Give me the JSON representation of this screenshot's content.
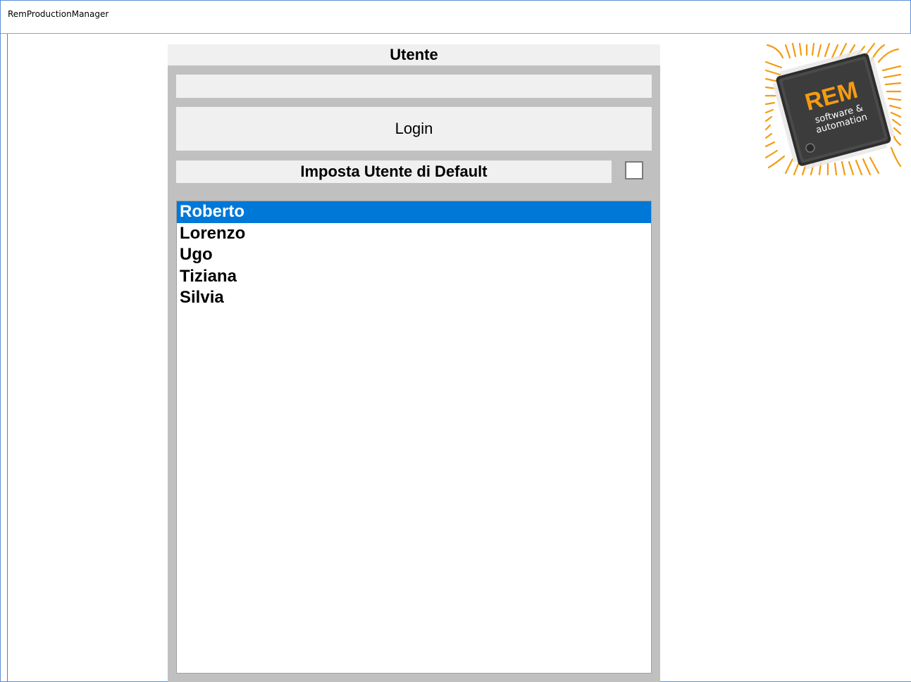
{
  "window": {
    "title": "RemProductionManager"
  },
  "panel": {
    "title": "Utente",
    "password": {
      "value": "",
      "placeholder": ""
    },
    "login_label": "Login",
    "default_user_label": "Imposta Utente di Default",
    "default_user_checked": false
  },
  "users": [
    {
      "name": "Roberto",
      "selected": true
    },
    {
      "name": "Lorenzo",
      "selected": false
    },
    {
      "name": "Ugo",
      "selected": false
    },
    {
      "name": "Tiziana",
      "selected": false
    },
    {
      "name": "Silvia",
      "selected": false
    }
  ],
  "logo": {
    "brand": "REM",
    "tagline_line1": "software &",
    "tagline_line2": "automation",
    "chip_color": "#3a3a3a",
    "accent_color": "#f39c12",
    "icon": "microchip-logo"
  },
  "colors": {
    "selection": "#0078d7",
    "panel_bg": "#c0c0c0",
    "control_bg": "#f0f0f0"
  }
}
